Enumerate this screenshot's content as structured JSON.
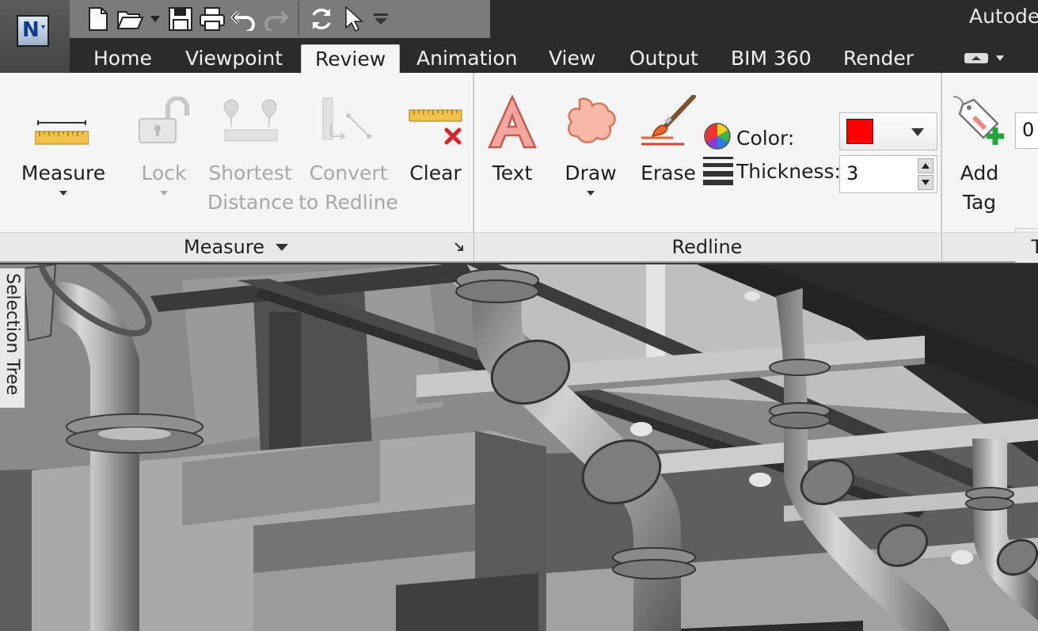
{
  "app": {
    "name": "Autode",
    "logo_letter": "N"
  },
  "tabs": [
    "Home",
    "Viewpoint",
    "Review",
    "Animation",
    "View",
    "Output",
    "BIM 360",
    "Render"
  ],
  "active_tab": "Review",
  "measure_panel": {
    "buttons": [
      {
        "line1": "Measure",
        "line2": "",
        "enabled": true
      },
      {
        "line1": "Lock",
        "line2": "",
        "enabled": false
      },
      {
        "line1": "Shortest",
        "line2": "Distance",
        "enabled": false
      },
      {
        "line1": "Convert",
        "line2": "to Redline",
        "enabled": false
      },
      {
        "line1": "Clear",
        "line2": "",
        "enabled": true
      }
    ],
    "footer": "Measure"
  },
  "redline_panel": {
    "text_label": "Text",
    "draw_label": "Draw",
    "erase_label": "Erase",
    "color_label": "Color:",
    "color_value": "#ff0000",
    "thickness_label": "Thickness:",
    "thickness_value": "3",
    "footer": "Redline"
  },
  "tags_panel": {
    "add_tag_line1": "Add",
    "add_tag_line2": "Tag",
    "tag_id_value": "0",
    "footer": "T"
  },
  "side_panel": {
    "selection_tree_label": "Selection Tree"
  },
  "colors": {
    "ribbon_bg": "#f5f5f5",
    "tab_bar": "#2b2b2b",
    "qat_bg": "#7a7a7a",
    "redline_red": "#ff0000"
  }
}
